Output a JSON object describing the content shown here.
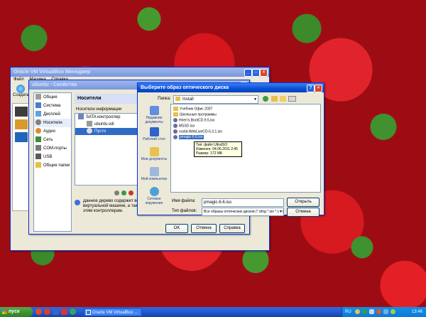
{
  "colors": {
    "titlebar": "#0a50d8",
    "selection": "#316ac5",
    "desktop": "#c4161c"
  },
  "vbox_manager": {
    "title": "Oracle VM VirtualBox Менеджер",
    "menu": [
      "Файл",
      "Машина",
      "Справка"
    ],
    "create_label": "Создать"
  },
  "settings": {
    "title": "ubuntu - Свойства",
    "categories": [
      "Общие",
      "Система",
      "Дисплей",
      "Носители",
      "Аудио",
      "Сеть",
      "COM-порты",
      "USB",
      "Общие папки"
    ],
    "page_title": "Носители",
    "tree_header": "Носители информации",
    "tree": [
      {
        "label": "SATA контроллер",
        "icon": "controller-icon"
      },
      {
        "label": "ubuntu.vdi",
        "icon": "hard-disk-icon"
      },
      {
        "label": "Пусто",
        "icon": "cd-icon"
      }
    ],
    "info_text": "Данное дерево содержит все конт виртуальной машине, а так же ас этим контроллерам.",
    "buttons": {
      "ok": "OK",
      "cancel": "Отмена",
      "help": "Справка"
    }
  },
  "file_dialog": {
    "title": "Выберите образ оптического диска",
    "look_in_label": "Папка:",
    "look_in_value": "Install",
    "places": [
      "Недавние документы",
      "Рабочий стол",
      "Мои документы",
      "Мой компьютер",
      "Сетевое окружение"
    ],
    "files": [
      "Учебник Офис 2007",
      "Школьные программы",
      "Hiren's.BootCD.9.5.iso",
      "MSSD.iso",
      "rosbit-WebLiveCD-5.3.1.iso",
      "pmagic-6.6.iso"
    ],
    "tooltip": [
      "Тип: файл UltraISO",
      "Изменен: 04.06.2011 2:45",
      "Размер: 172 МБ"
    ],
    "filename_label": "Имя файла:",
    "filename_value": "pmagic-6.6.iso",
    "filetype_label": "Тип файлов:",
    "filetype_value": "Все образы оптических дисков (*.dmg *.iso *.cdr)",
    "open_label": "Открыть",
    "cancel_label": "Отмена"
  },
  "taskbar": {
    "start_label": "пуск",
    "task_label": "Oracle VM VirtualBox ...",
    "lang": "RU",
    "clock": "13:46"
  }
}
